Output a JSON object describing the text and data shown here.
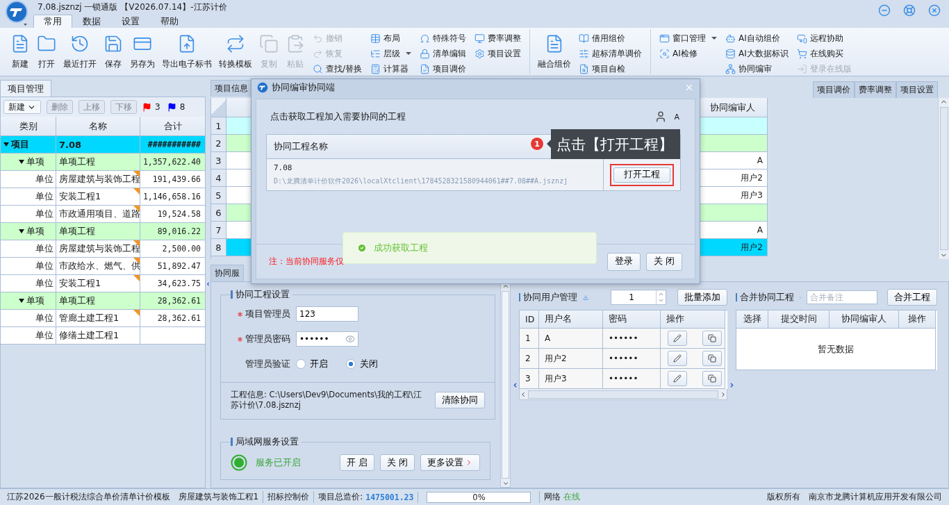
{
  "window": {
    "title": "7.08.jsznzj 一锁通版 【V2026.07.14】-江苏计价"
  },
  "menu_tabs": [
    {
      "label": "常用",
      "selected": true
    },
    {
      "label": "数据",
      "selected": false
    },
    {
      "label": "设置",
      "selected": false
    },
    {
      "label": "帮助",
      "selected": false
    }
  ],
  "ribbon": [
    {
      "large": [
        {
          "label": "新建",
          "disabled": false
        },
        {
          "label": "打开",
          "disabled": false
        },
        {
          "label": "最近打开",
          "disabled": false
        },
        {
          "label": "保存",
          "disabled": false
        },
        {
          "label": "另存为",
          "disabled": false
        },
        {
          "label": "导出电子标书",
          "disabled": false
        },
        {
          "label": "转换模板",
          "disabled": false
        },
        {
          "label": "复制",
          "disabled": true
        },
        {
          "label": "粘贴",
          "disabled": true
        }
      ],
      "columns": [
        [
          {
            "label": "撤销",
            "disabled": true,
            "menu": false
          },
          {
            "label": "恢复",
            "disabled": true,
            "menu": false
          },
          {
            "label": "查找/替换",
            "disabled": false,
            "menu": false
          }
        ],
        [
          {
            "label": "布局",
            "disabled": false,
            "menu": false
          },
          {
            "label": "层级",
            "disabled": false,
            "menu": true
          },
          {
            "label": "计算器",
            "disabled": false,
            "menu": false
          }
        ],
        [
          {
            "label": "特殊符号",
            "disabled": false,
            "menu": false
          },
          {
            "label": "清单编辑",
            "disabled": false,
            "menu": false
          },
          {
            "label": "项目调价",
            "disabled": false,
            "menu": false
          }
        ],
        [
          {
            "label": "费率调整",
            "disabled": false,
            "menu": false
          },
          {
            "label": "项目设置",
            "disabled": false,
            "menu": false
          }
        ]
      ]
    },
    {
      "large": [
        {
          "label": "融合组价",
          "disabled": false
        }
      ],
      "columns": [
        [
          {
            "label": "借用组价",
            "disabled": false,
            "menu": false
          },
          {
            "label": "超标清单调价",
            "disabled": false,
            "menu": false
          },
          {
            "label": "项目自检",
            "disabled": false,
            "menu": false
          }
        ]
      ]
    },
    {
      "columns": [
        [
          {
            "label": "窗口管理",
            "disabled": false,
            "menu": true
          },
          {
            "label": "AI检修",
            "disabled": false,
            "menu": false
          }
        ],
        [
          {
            "label": "AI自动组价",
            "disabled": false,
            "menu": false
          },
          {
            "label": "AI大数据标识",
            "disabled": false,
            "menu": false
          },
          {
            "label": "协同编审",
            "disabled": false,
            "menu": false
          }
        ],
        [
          {
            "label": "远程协助",
            "disabled": false,
            "menu": false
          },
          {
            "label": "在线购买",
            "disabled": false,
            "menu": false
          },
          {
            "label": "登录在线版",
            "disabled": true,
            "menu": false
          }
        ]
      ]
    }
  ],
  "left_panel": {
    "tab": "项目管理",
    "toolbar": [
      {
        "label": "新建",
        "disabled": false,
        "menu": true
      },
      {
        "label": "删除",
        "disabled": true,
        "menu": false
      },
      {
        "label": "上移",
        "disabled": true,
        "menu": false
      },
      {
        "label": "下移",
        "disabled": true,
        "menu": false
      }
    ],
    "flags": [
      {
        "count": "3",
        "color": "#ff0000"
      },
      {
        "count": "8",
        "color": "#0000ff"
      }
    ],
    "tree": {
      "columns": [
        "类别",
        "名称",
        "合计"
      ],
      "rows": [
        {
          "kind": "project",
          "category": "项目",
          "name": "7.08",
          "total": "###########",
          "expanded": true,
          "selected": true,
          "children": [
            {
              "kind": "single",
              "category": "单项",
              "name": "单项工程",
              "total": "1,357,622.40",
              "expanded": true,
              "selected": false,
              "children": [
                {
                  "kind": "unit",
                  "category": "单位",
                  "name": "房屋建筑与装饰工程",
                  "total": "191,439.66",
                  "marked": true,
                  "selected": false
                },
                {
                  "kind": "unit",
                  "category": "单位",
                  "name": "安装工程1",
                  "total": "1,146,658.16",
                  "marked": true,
                  "selected": false
                },
                {
                  "kind": "unit",
                  "category": "单位",
                  "name": "市政通用项目、道路",
                  "total": "19,524.58",
                  "marked": true,
                  "selected": false
                }
              ]
            },
            {
              "kind": "single",
              "category": "单项",
              "name": "单项工程",
              "total": "89,016.22",
              "expanded": true,
              "selected": false,
              "children": [
                {
                  "kind": "unit",
                  "category": "单位",
                  "name": "房屋建筑与装饰工程",
                  "total": "2,500.00",
                  "marked": true,
                  "selected": false
                },
                {
                  "kind": "unit",
                  "category": "单位",
                  "name": "市政给水、燃气、供",
                  "total": "51,892.47",
                  "marked": true,
                  "selected": false
                },
                {
                  "kind": "unit",
                  "category": "单位",
                  "name": "安装工程1",
                  "total": "34,623.75",
                  "marked": true,
                  "selected": false
                }
              ]
            },
            {
              "kind": "single",
              "category": "单项",
              "name": "单项工程",
              "total": "28,362.61",
              "expanded": true,
              "selected": false,
              "children": [
                {
                  "kind": "unit",
                  "category": "单位",
                  "name": "管廊土建工程1",
                  "total": "28,362.61",
                  "marked": true,
                  "selected": false
                },
                {
                  "kind": "unit",
                  "category": "单位",
                  "name": "修缮土建工程1",
                  "marked": false,
                  "selected": false
                }
              ]
            }
          ]
        }
      ]
    }
  },
  "center": {
    "info_tab": "项目信息",
    "right_tabs": [
      "项目调价",
      "费率调整",
      "项目设置"
    ],
    "grid": {
      "reviewer_column": "协同编审人",
      "rows": [
        {
          "number": "1",
          "kind": "project",
          "selected": false
        },
        {
          "number": "2",
          "kind": "single",
          "selected": false
        },
        {
          "number": "3",
          "kind": "unit",
          "selected": false,
          "reviewer": "A"
        },
        {
          "number": "4",
          "kind": "unit",
          "selected": false,
          "reviewer": "用户2"
        },
        {
          "number": "5",
          "kind": "unit",
          "selected": false,
          "reviewer": "用户3"
        },
        {
          "number": "6",
          "kind": "single",
          "selected": false
        },
        {
          "number": "7",
          "kind": "unit",
          "selected": false,
          "reviewer": "A"
        },
        {
          "number": "8",
          "kind": "unit",
          "selected": true,
          "reviewer": "用户2"
        }
      ]
    }
  },
  "dialog": {
    "title": "协同编审协同端",
    "prompt": "点击获取工程加入需要协同的工程",
    "user": "A",
    "table": {
      "column": "协同工程名称",
      "rows": [
        {
          "name": "7.08",
          "path": "D:\\龙腾清单计价软件2026\\localXtclient\\1784528321580944061##7.08##A.jsznzj",
          "action": "打开工程",
          "highlighted": true
        }
      ]
    },
    "note": "注：当前协同服务仅",
    "buttons": [
      "登录",
      "关 闭"
    ]
  },
  "tooltip": {
    "badge": "1",
    "text": "点击【打开工程】"
  },
  "toast": {
    "text": "成功获取工程"
  },
  "collab": {
    "tab": "协同服",
    "settings": {
      "title": "协同工程设置",
      "admin": {
        "label": "项目管理员",
        "required": true,
        "value": "123"
      },
      "password": {
        "label": "管理员密码",
        "required": true,
        "value": "••••••"
      },
      "verify": {
        "label": "管理员验证",
        "options": [
          {
            "label": "开启",
            "selected": false
          },
          {
            "label": "关闭",
            "selected": true
          }
        ]
      },
      "info": "工程信息: C:\\Users\\Dev9\\Documents\\我的工程\\江苏计价\\7.08.jsznzj",
      "clear_button": "清除协同"
    },
    "lan": {
      "title": "局域网服务设置",
      "running": true,
      "status": "服务已开启",
      "buttons": [
        "开 启",
        "关 闭",
        "更多设置"
      ]
    },
    "users": {
      "title": "协同用户管理",
      "count": "1",
      "add_button": "批量添加",
      "columns": [
        "ID",
        "用户名",
        "密码",
        "操作"
      ],
      "rows": [
        {
          "id": "1",
          "name": "A",
          "password": "••••••"
        },
        {
          "id": "2",
          "name": "用户2",
          "password": "••••••"
        },
        {
          "id": "3",
          "name": "用户3",
          "password": "••••••"
        }
      ]
    },
    "merge": {
      "title": "合并协同工程",
      "placeholder": "合并备注",
      "button": "合并工程",
      "columns": [
        "选择",
        "提交时间",
        "协同编审人",
        "操作"
      ],
      "empty": "暂无数据"
    }
  },
  "status_bar": {
    "template": "江苏2026一般计税法综合单价清单计价模板",
    "unit": "房屋建筑与装饰工程1",
    "mode": "招标控制价",
    "total_label": "项目总造价:",
    "total": "1475001.23",
    "progress": {
      "level": 0,
      "reading": "0%"
    },
    "network_label": "网络",
    "network_status": "在线",
    "copyright": "版权所有",
    "company": "南京市龙腾计算机应用开发有限公司"
  }
}
